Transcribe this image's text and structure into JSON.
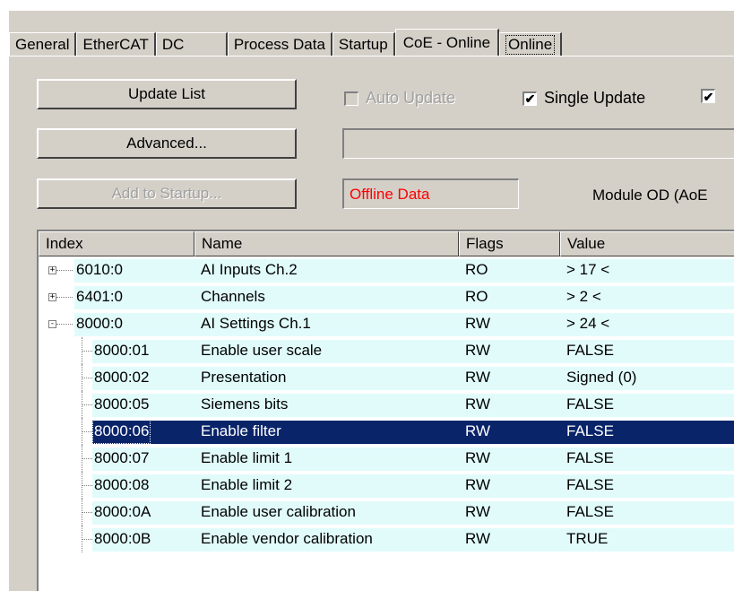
{
  "tabs": [
    {
      "label": "General",
      "active": false
    },
    {
      "label": "EtherCAT",
      "active": false
    },
    {
      "label": "DC",
      "active": false
    },
    {
      "label": "Process Data",
      "active": false
    },
    {
      "label": "Startup",
      "active": false
    },
    {
      "label": "CoE - Online",
      "active": true
    },
    {
      "label": "Online",
      "active": false
    }
  ],
  "buttons": {
    "update_list": "Update List",
    "advanced": "Advanced...",
    "add_to_startup": "Add to Startup..."
  },
  "checkboxes": {
    "auto_update": {
      "label": "Auto Update",
      "checked": false,
      "enabled": false
    },
    "single_update": {
      "label": "Single Update",
      "checked": true,
      "enabled": true
    },
    "third": {
      "label": "",
      "checked": true,
      "enabled": true
    }
  },
  "status": {
    "offline_text": "Offline Data",
    "module_od_text": "Module OD (AoE"
  },
  "colors": {
    "row_background": "#e1fbfb",
    "selection": "#0a246a",
    "offline_text": "#ff0000"
  },
  "table": {
    "columns": [
      "Index",
      "Name",
      "Flags",
      "Value"
    ],
    "rows": [
      {
        "index": "6010:0",
        "name": "AI Inputs Ch.2",
        "flags": "RO",
        "value": "> 17 <",
        "level": 0,
        "expander": "+"
      },
      {
        "index": "6401:0",
        "name": "Channels",
        "flags": "RO",
        "value": "> 2 <",
        "level": 0,
        "expander": "+"
      },
      {
        "index": "8000:0",
        "name": "AI Settings Ch.1",
        "flags": "RW",
        "value": "> 24 <",
        "level": 0,
        "expander": "-"
      },
      {
        "index": "8000:01",
        "name": "Enable user scale",
        "flags": "RW",
        "value": "FALSE",
        "level": 1
      },
      {
        "index": "8000:02",
        "name": "Presentation",
        "flags": "RW",
        "value": "Signed (0)",
        "level": 1
      },
      {
        "index": "8000:05",
        "name": "Siemens bits",
        "flags": "RW",
        "value": "FALSE",
        "level": 1
      },
      {
        "index": "8000:06",
        "name": "Enable filter",
        "flags": "RW",
        "value": "FALSE",
        "level": 1,
        "selected": true
      },
      {
        "index": "8000:07",
        "name": "Enable limit 1",
        "flags": "RW",
        "value": "FALSE",
        "level": 1
      },
      {
        "index": "8000:08",
        "name": "Enable limit 2",
        "flags": "RW",
        "value": "FALSE",
        "level": 1
      },
      {
        "index": "8000:0A",
        "name": "Enable user calibration",
        "flags": "RW",
        "value": "FALSE",
        "level": 1
      },
      {
        "index": "8000:0B",
        "name": "Enable vendor calibration",
        "flags": "RW",
        "value": "TRUE",
        "level": 1
      }
    ]
  }
}
